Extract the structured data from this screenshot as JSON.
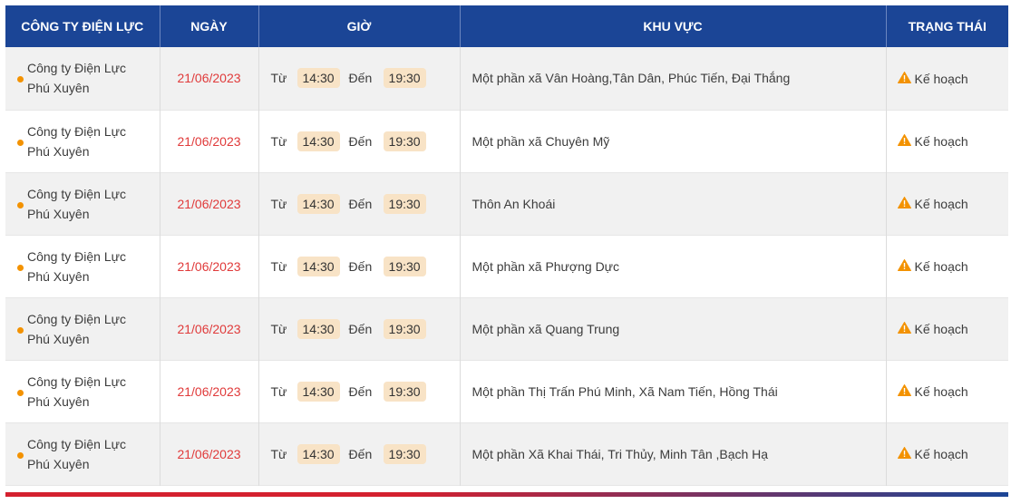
{
  "headers": {
    "company": "CÔNG TY ĐIỆN LỰC",
    "date": "NGÀY",
    "time": "GIỜ",
    "area": "KHU VỰC",
    "status": "TRẠNG THÁI"
  },
  "labels": {
    "from": "Từ",
    "to": "Đến"
  },
  "colors": {
    "header_bg": "#1b4596",
    "date_text": "#e03a3a",
    "dot": "#f39200",
    "time_pill": "#f8e3c6",
    "warning": "#f39200"
  },
  "rows": [
    {
      "company_line1": "Công ty Điện Lực",
      "company_line2": "Phú Xuyên",
      "date": "21/06/2023",
      "start": "14:30",
      "end": "19:30",
      "area": "Một phần xã Vân Hoàng,Tân Dân, Phúc Tiến, Đại Thắng",
      "status": "Kế hoạch",
      "status_icon": "warning-icon"
    },
    {
      "company_line1": "Công ty Điện Lực",
      "company_line2": "Phú Xuyên",
      "date": "21/06/2023",
      "start": "14:30",
      "end": "19:30",
      "area": "Một phần xã Chuyên Mỹ",
      "status": "Kế hoạch",
      "status_icon": "warning-icon"
    },
    {
      "company_line1": "Công ty Điện Lực",
      "company_line2": "Phú Xuyên",
      "date": "21/06/2023",
      "start": "14:30",
      "end": "19:30",
      "area": "Thôn An Khoái",
      "status": "Kế hoạch",
      "status_icon": "warning-icon"
    },
    {
      "company_line1": "Công ty Điện Lực",
      "company_line2": "Phú Xuyên",
      "date": "21/06/2023",
      "start": "14:30",
      "end": "19:30",
      "area": "Một phần xã Phượng Dực",
      "status": "Kế hoạch",
      "status_icon": "warning-icon"
    },
    {
      "company_line1": "Công ty Điện Lực",
      "company_line2": "Phú Xuyên",
      "date": "21/06/2023",
      "start": "14:30",
      "end": "19:30",
      "area": "Một phần xã Quang Trung",
      "status": "Kế hoạch",
      "status_icon": "warning-icon"
    },
    {
      "company_line1": "Công ty Điện Lực",
      "company_line2": "Phú Xuyên",
      "date": "21/06/2023",
      "start": "14:30",
      "end": "19:30",
      "area": "Một phần Thị Trấn Phú Minh, Xã Nam Tiến, Hồng Thái",
      "status": "Kế hoạch",
      "status_icon": "warning-icon"
    },
    {
      "company_line1": "Công ty Điện Lực",
      "company_line2": "Phú Xuyên",
      "date": "21/06/2023",
      "start": "14:30",
      "end": "19:30",
      "area": "Một phần Xã Khai Thái, Tri Thủy, Minh Tân ,Bạch Hạ",
      "status": "Kế hoạch",
      "status_icon": "warning-icon"
    }
  ]
}
